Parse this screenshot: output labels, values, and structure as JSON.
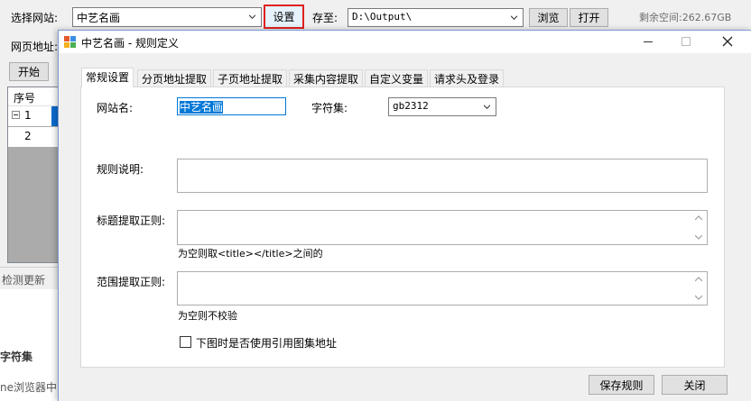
{
  "main_window": {
    "site_label": "选择网站:",
    "site_value": "中艺名画",
    "settings_label": "设置",
    "save_to_label": "存至:",
    "save_path": "D:\\Output\\",
    "browse_label": "浏览",
    "open_label": "打开",
    "free_space": "剩余空间:262.67GB",
    "url_label": "网页地址:",
    "start_label": "开始",
    "table_header": "序号",
    "rows": [
      "1",
      "2"
    ],
    "status": "检测更新",
    "bg_heading": "字符集",
    "bg_text": "ne浏览器中"
  },
  "dialog": {
    "title": "中艺名画 - 规则定义",
    "tabs": [
      "常规设置",
      "分页地址提取",
      "子页地址提取",
      "采集内容提取",
      "自定义变量",
      "请求头及登录"
    ],
    "site_name_label": "网站名:",
    "site_name_value": "中艺名画",
    "charset_label": "字符集:",
    "charset_value": "gb2312",
    "rule_desc_label": "规则说明:",
    "title_regex_label": "标题提取正则:",
    "title_hint": "为空则取<title></title>之间的",
    "range_regex_label": "范围提取正则:",
    "range_hint": "为空则不校验",
    "checkbox_label": "下图时是否使用引用图集地址",
    "save_rule_label": "保存规则",
    "close_label": "关闭"
  }
}
